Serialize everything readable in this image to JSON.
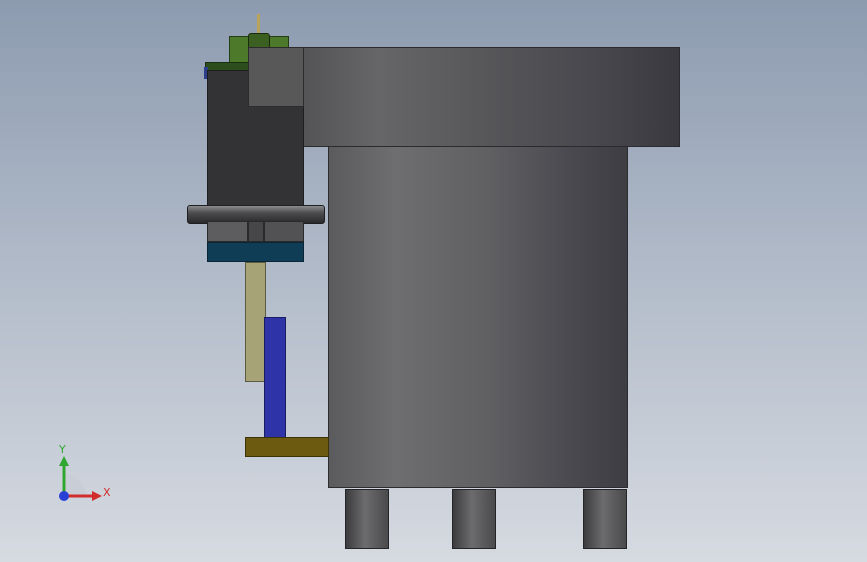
{
  "scene": {
    "view": "front",
    "background_color": "#a9b3c2",
    "parts": [
      {
        "name": "tank-body",
        "color": "#616163"
      },
      {
        "name": "tank-flange",
        "color": "#59595b"
      },
      {
        "name": "motor-housing",
        "color": "#333335"
      },
      {
        "name": "motor-green",
        "color": "#4c7a2a"
      },
      {
        "name": "motor-base",
        "color": "#0e3d55"
      },
      {
        "name": "olive-post",
        "color": "#a6a377"
      },
      {
        "name": "blue-post",
        "color": "#2f33a8"
      },
      {
        "name": "brown-plate",
        "color": "#6b5a10"
      }
    ]
  },
  "triad": {
    "y_label": "Y",
    "x_label": "X",
    "y_color": "#2fa62f",
    "x_color": "#d22d2d",
    "z_color": "#2a3fd6"
  }
}
